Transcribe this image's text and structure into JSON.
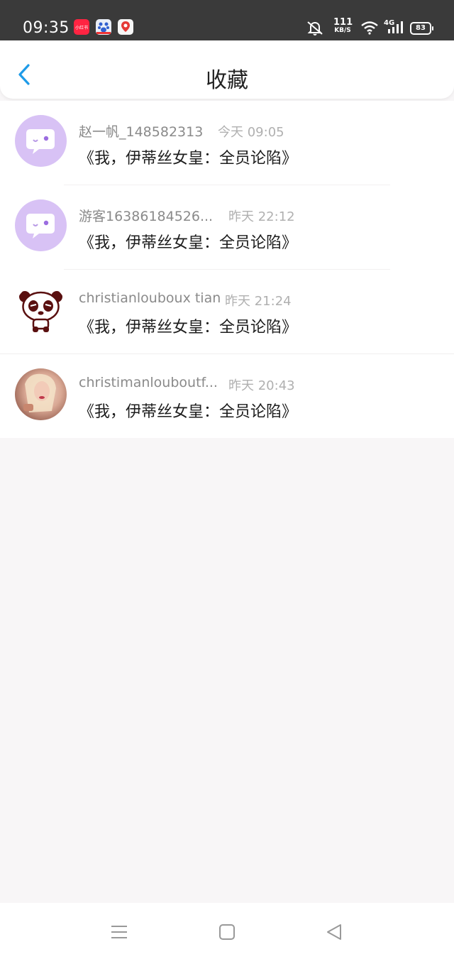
{
  "status_bar": {
    "time": "09:35",
    "app_badge_1_text": "小红书",
    "net_speed_value": "111",
    "net_speed_unit": "KB/S",
    "network_type": "4G",
    "battery": "83"
  },
  "header": {
    "title": "收藏"
  },
  "items": [
    {
      "name": "赵一帆_148582313",
      "time": "今天 09:05",
      "book": "《我，伊蒂丝女皇：全员论陷》",
      "avatar": "purple-chat-avatar"
    },
    {
      "name": "游客16386184526...",
      "time": "昨天 22:12",
      "book": "《我，伊蒂丝女皇：全员论陷》",
      "avatar": "purple-chat-avatar"
    },
    {
      "name": "christianlouboux tian",
      "time": "昨天 21:24",
      "book": "《我，伊蒂丝女皇：全员论陷》",
      "avatar": "panda-avatar"
    },
    {
      "name": "christimanlouboutf...",
      "time": "昨天 20:43",
      "book": "《我，伊蒂丝女皇：全员论陷》",
      "avatar": "photo-avatar"
    }
  ],
  "colors": {
    "accent": "#1e9be8",
    "status_bar_bg": "#3a3a3a",
    "avatar_purple": "#d8c2f5",
    "page_bg": "#f8f6f7"
  }
}
